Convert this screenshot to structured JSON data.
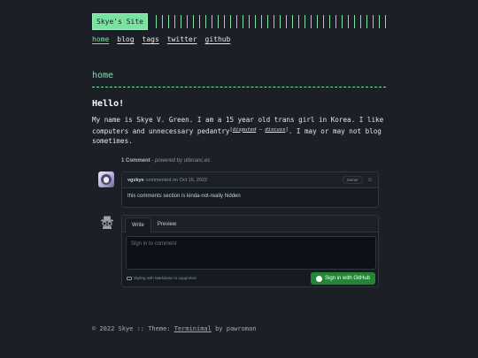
{
  "header": {
    "site_title": "Skye's Site"
  },
  "nav": {
    "items": [
      "home",
      "blog",
      "tags",
      "twitter",
      "github"
    ]
  },
  "page": {
    "title": "home",
    "post_title": "Hello!",
    "intro_1": "My name is Skye V. Green. I am a 15 year old trans girl in Korea. I like computers and unnecessary pedantry",
    "disputed": "disputed",
    "sep": " – ",
    "discuss": "discuss",
    "intro_2": ". I may or may not blog sometimes."
  },
  "comments": {
    "count_label": "1 Comment",
    "powered_by": " - powered by utteranc.es",
    "items": [
      {
        "author": "vgskye",
        "meta": "commented on Oct 16, 2022",
        "badge": "Owner",
        "reaction_icon": "smiley-icon",
        "body": "this comments section is kinda-not-really hidden"
      }
    ],
    "editor": {
      "tab_write": "Write",
      "tab_preview": "Preview",
      "placeholder": "Sign in to comment",
      "markdown_note": "Styling with Markdown is supported",
      "signin_button": "Sign in with GitHub"
    }
  },
  "footer": {
    "prefix": "© 2022 Skye :: Theme: ",
    "theme_link": "Terminimal",
    "suffix": " by pawroman"
  },
  "colors": {
    "accent": "#78e2a0",
    "background": "#1d1f27",
    "github_green": "#238636"
  }
}
